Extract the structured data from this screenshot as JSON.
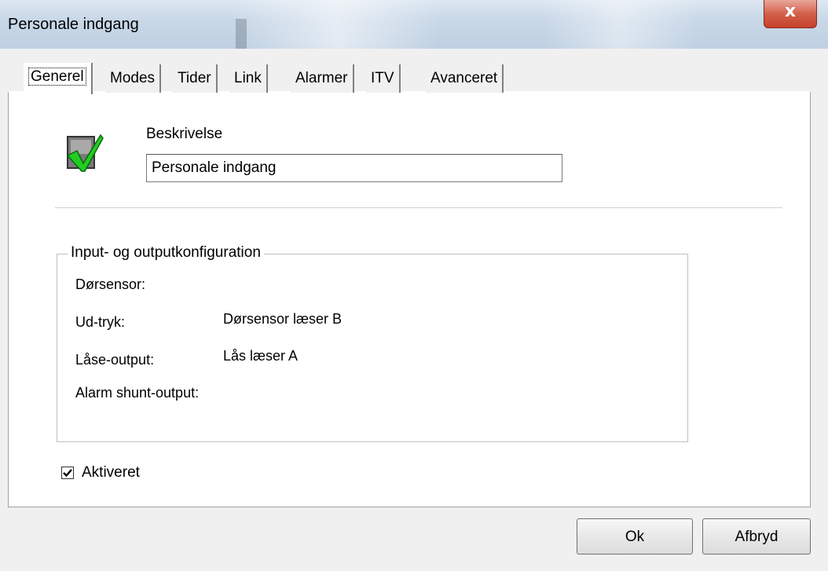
{
  "window": {
    "title": "Personale indgang",
    "close_glyph": "x"
  },
  "tabs": [
    {
      "label": "Generel",
      "active": true
    },
    {
      "label": "Modes"
    },
    {
      "label": "Tider"
    },
    {
      "label": "Link"
    },
    {
      "label": "Alarmer"
    },
    {
      "label": "ITV"
    },
    {
      "label": "Avanceret"
    }
  ],
  "general": {
    "icon": "door-enabled-check-icon",
    "description_label": "Beskrivelse",
    "description_value": "Personale indgang",
    "io_group_title": "Input- og outputkonfiguration",
    "io_rows": [
      {
        "label": "Dørsensor:",
        "value": ""
      },
      {
        "label": "Ud-tryk:",
        "value": "Dørsensor læser B"
      },
      {
        "label": "Låse-output:",
        "value": "Lås læser A"
      },
      {
        "label": "Alarm shunt-output:",
        "value": ""
      }
    ],
    "enabled_label": "Aktiveret",
    "enabled_checked": true
  },
  "buttons": {
    "ok": "Ok",
    "cancel": "Afbryd"
  },
  "colors": {
    "check_green": "#2ecc2e",
    "close_red": "#c5412a"
  }
}
